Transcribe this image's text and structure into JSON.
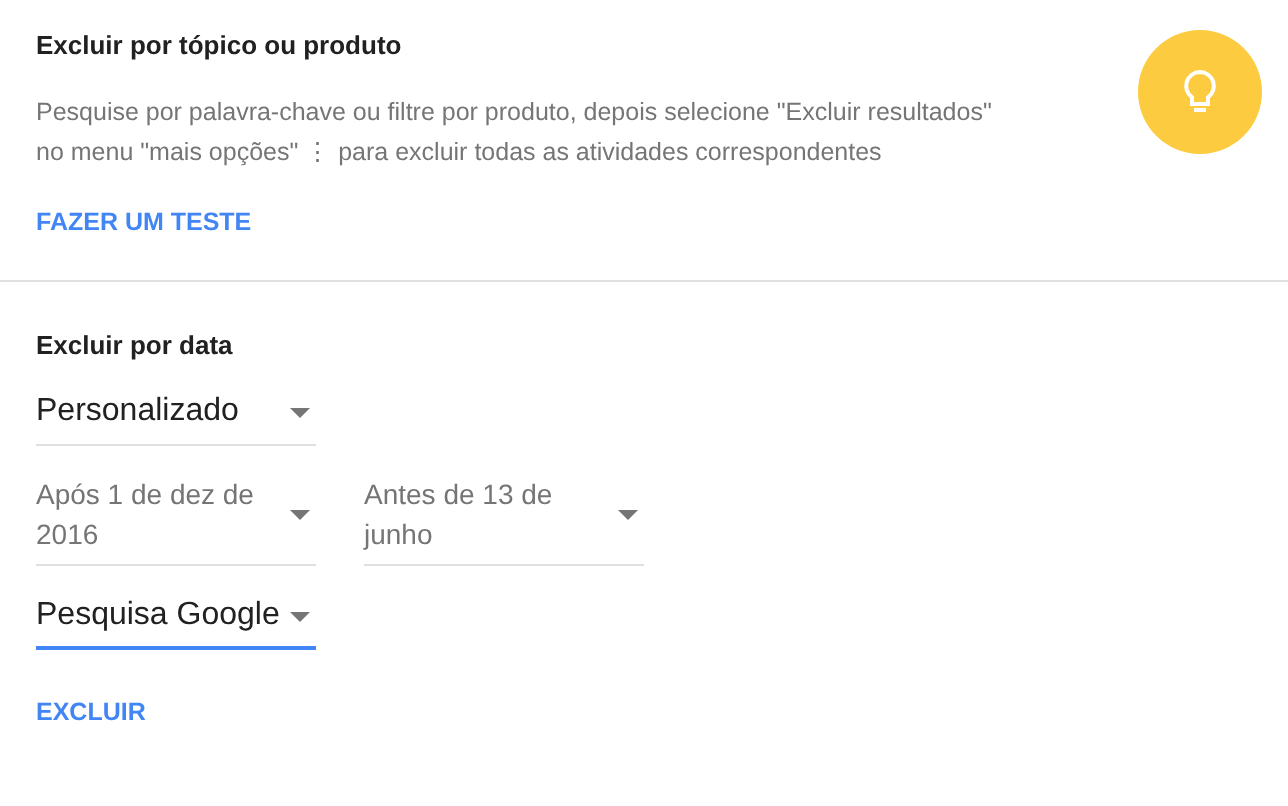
{
  "topic_section": {
    "title": "Excluir por tópico ou produto",
    "description_lines": [
      "Pesquise por palavra-chave ou filtre por produto, depois selecione \"Excluir resultados\"",
      "no menu \"mais opções\" ⋮ para excluir todas as atividades correspondentes"
    ],
    "link": "FAZER UM TESTE"
  },
  "date_section": {
    "title": "Excluir por data",
    "rows": [
      [
        {
          "kind": "value",
          "text": "Personalizado",
          "focused": false
        }
      ],
      [
        {
          "kind": "date",
          "text": "Após 1 de dez de 2016",
          "focused": false
        },
        {
          "kind": "date",
          "text": "Antes de 13 de junho",
          "focused": false
        }
      ],
      [
        {
          "kind": "value",
          "text": "Pesquisa Google",
          "focused": true
        }
      ]
    ],
    "action": "EXCLUIR"
  }
}
